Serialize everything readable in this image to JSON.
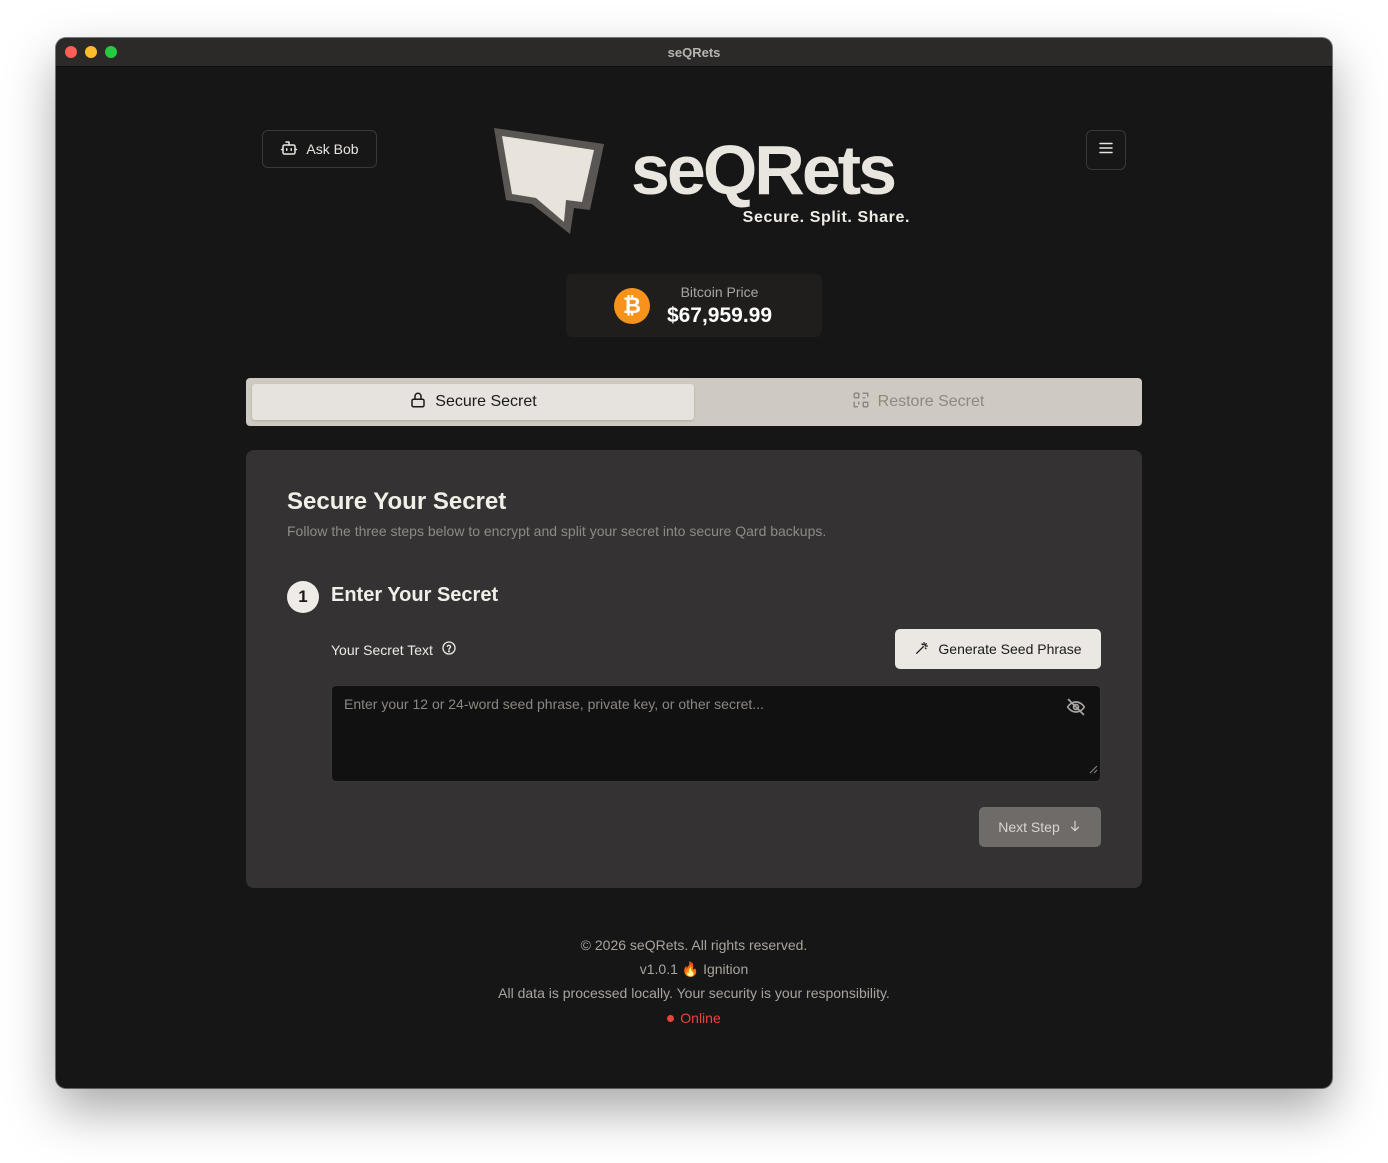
{
  "window": {
    "title": "seQRets"
  },
  "header": {
    "ask_bob_label": "Ask Bob",
    "brand": "seQRets",
    "tagline": "Secure. Split. Share."
  },
  "price": {
    "label": "Bitcoin Price",
    "value": "$67,959.99",
    "coin_symbol": "₿"
  },
  "tabs": [
    {
      "label": "Secure Secret",
      "icon": "lock-icon",
      "active": true
    },
    {
      "label": "Restore Secret",
      "icon": "qr-scan-icon",
      "active": false
    }
  ],
  "card": {
    "title": "Secure Your Secret",
    "subtitle": "Follow the three steps below to encrypt and split your secret into secure Qard backups.",
    "step": {
      "number": "1",
      "title": "Enter Your Secret",
      "field_label": "Your Secret Text",
      "generate_label": "Generate Seed Phrase",
      "placeholder": "Enter your 12 or 24-word seed phrase, private key, or other secret...",
      "next_label": "Next Step"
    }
  },
  "footer": {
    "copyright": "© 2026 seQRets. All rights reserved.",
    "version": "v1.0.1",
    "release_emoji": "🔥",
    "release_name": "Ignition",
    "notice": "All data is processed locally. Your security is your responsibility.",
    "status": "Online"
  },
  "colors": {
    "background": "#171616",
    "card": "#353233",
    "tabs": "#cfcac1",
    "bitcoin": "#f7931a",
    "status_online": "#e8443a"
  }
}
